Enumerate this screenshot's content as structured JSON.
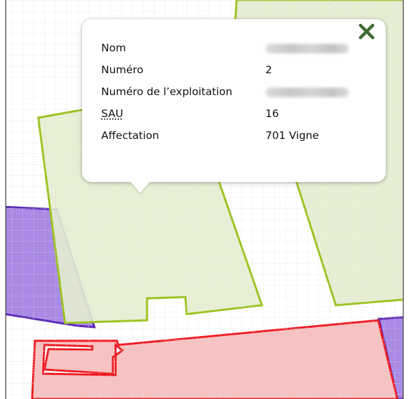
{
  "map": {
    "parcel_colors": {
      "vigne": "#9bc31f",
      "vigne_fill": "#e6efd2",
      "purple": "#5b2ab8",
      "purple_fill": "#a98be6",
      "red": "#ee1c24",
      "red_fill": "#f7c2c2",
      "grid": "#d7d7d7"
    }
  },
  "popup": {
    "close_icon": "close-icon",
    "close_color": "#3c6b33",
    "rows": [
      {
        "key": "Nom",
        "value": "",
        "redacted": true
      },
      {
        "key": "Numéro",
        "value": "2",
        "redacted": false
      },
      {
        "key": "Numéro de l’exploitation",
        "value": "",
        "redacted": true
      },
      {
        "key": "SAU",
        "value": "16",
        "redacted": false,
        "abbr": true
      },
      {
        "key": "Affectation",
        "value": "701 Vigne",
        "redacted": false
      }
    ]
  }
}
